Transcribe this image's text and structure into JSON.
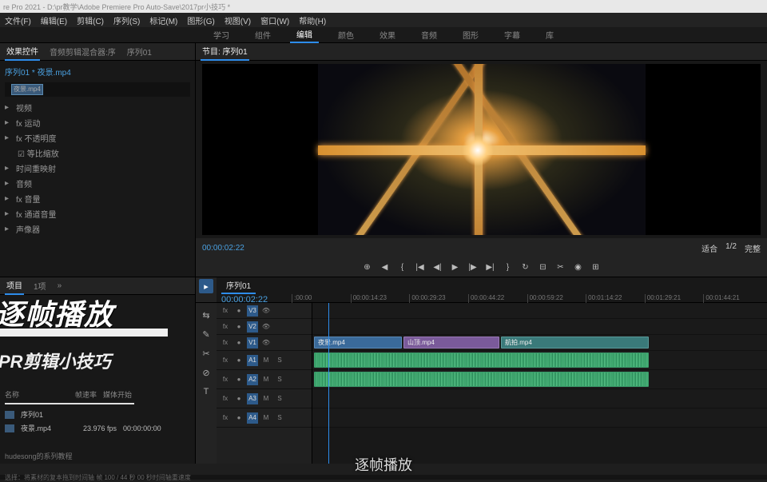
{
  "title_bar": "re Pro 2021 - D:\\pr教学\\Adobe Premiere Pro Auto-Save\\2017pr小技巧 *",
  "menu": [
    "文件(F)",
    "编辑(E)",
    "剪辑(C)",
    "序列(S)",
    "标记(M)",
    "图形(G)",
    "视图(V)",
    "窗口(W)",
    "帮助(H)"
  ],
  "workspaces": [
    "学习",
    "组件",
    "编辑",
    "颜色",
    "效果",
    "音频",
    "图形",
    "字幕",
    "库"
  ],
  "active_workspace": "编辑",
  "effect_panel": {
    "tabs": [
      "效果控件",
      "音频剪辑混合器:序",
      "序列01"
    ],
    "active": 0,
    "clip_ref": "序列01 * 夜景.mp4",
    "timeline_label": "夜景.mp4",
    "groups": [
      "视频",
      "fx 运动",
      "fx 不透明度",
      "☑ 等比缩放",
      "时间重映射",
      "音频",
      "fx 音量",
      "fx 通道音量",
      "声像器"
    ]
  },
  "program": {
    "tab": "节目: 序列01",
    "tc_current": "00:00:02:22",
    "fit_label": "适合",
    "zoom": "1/2",
    "tc_total": "完整"
  },
  "transport_icons": [
    "⊕",
    "◀",
    "{",
    "|◀",
    "◀|",
    "▶",
    "|▶",
    "▶|",
    "}",
    "↻",
    "⊟",
    "✂",
    "◉",
    "⊞"
  ],
  "project": {
    "tabs": [
      "项目",
      "1项",
      "»"
    ],
    "bin": "名称",
    "cols": [
      "帧速率",
      "媒体开始"
    ],
    "items": [
      {
        "name": "序列01",
        "fps": "",
        "start": ""
      },
      {
        "name": "夜景.mp4",
        "fps": "23.976 fps",
        "start": "00:00:00:00"
      }
    ],
    "footer": "hudesong的系列教程"
  },
  "overlay": {
    "title": "逐帧播放",
    "subtitle": "PR剪辑小技巧"
  },
  "timeline": {
    "sequence_tab": "序列01",
    "tc": "00:00:02:22",
    "ruler": [
      ":00:00",
      "00:00:14:23",
      "00:00:29:23",
      "00:00:44:22",
      "00:00:59:22",
      "00:01:14:22",
      "00:01:29:21",
      "00:01:44:21"
    ],
    "video_tracks": [
      "V3",
      "V2",
      "V1"
    ],
    "audio_tracks": [
      "A1",
      "A2",
      "A3",
      "A4"
    ],
    "clips": {
      "v1_a": "夜景.mp4",
      "v1_b": "山顶.mp4",
      "v1_c": "航拍.mp4"
    },
    "tools": [
      "▸",
      "⇆",
      "✎",
      "✂",
      "⊘",
      "T"
    ]
  },
  "subtitle_text": "逐帧播放",
  "status_bar": "选择：将素材的复本拖到时间轴      帧 100 / 44 秒 00 秒时间轴重速度"
}
